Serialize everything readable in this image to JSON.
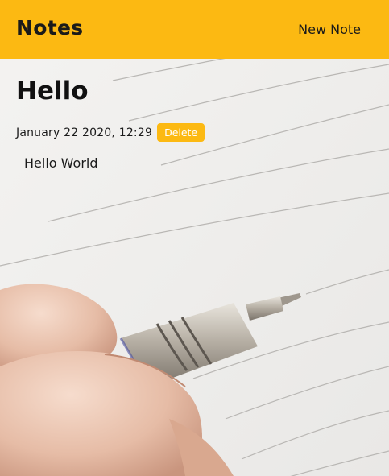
{
  "navbar": {
    "brand": "Notes",
    "new_note_link": "New Note",
    "color": "#fcb912"
  },
  "note": {
    "title": "Hello",
    "date": "January 22 2020, 12:29",
    "delete_label": "Delete",
    "body": "Hello World"
  },
  "background": {
    "image": "pen-writing-on-lined-notebook-photo"
  }
}
